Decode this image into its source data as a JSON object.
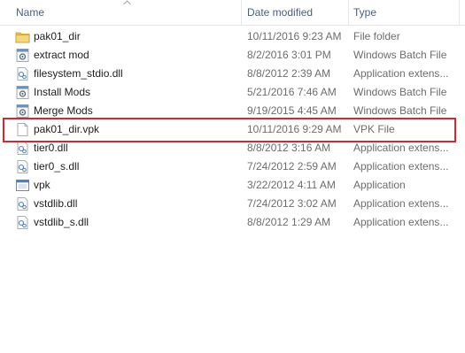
{
  "columns": {
    "name": "Name",
    "date": "Date modified",
    "type": "Type"
  },
  "colors": {
    "highlight": "#d7262f",
    "header_text": "#4c607a",
    "detail_text": "#6d6d6d"
  },
  "files": [
    {
      "name": "pak01_dir",
      "date": "10/11/2016 9:23 AM",
      "type": "File folder",
      "icon": "folder-icon"
    },
    {
      "name": "extract mod",
      "date": "8/2/2016 3:01 PM",
      "type": "Windows Batch File",
      "icon": "batch-file-icon"
    },
    {
      "name": "filesystem_stdio.dll",
      "date": "8/8/2012 2:39 AM",
      "type": "Application extens...",
      "icon": "dll-file-icon"
    },
    {
      "name": "Install Mods",
      "date": "5/21/2016 7:46 AM",
      "type": "Windows Batch File",
      "icon": "batch-file-icon"
    },
    {
      "name": "Merge Mods",
      "date": "9/19/2015 4:45 AM",
      "type": "Windows Batch File",
      "icon": "batch-file-icon"
    },
    {
      "name": "pak01_dir.vpk",
      "date": "10/11/2016 9:29 AM",
      "type": "VPK File",
      "icon": "blank-file-icon"
    },
    {
      "name": "tier0.dll",
      "date": "8/8/2012 3:16 AM",
      "type": "Application extens...",
      "icon": "dll-file-icon"
    },
    {
      "name": "tier0_s.dll",
      "date": "7/24/2012 2:59 AM",
      "type": "Application extens...",
      "icon": "dll-file-icon"
    },
    {
      "name": "vpk",
      "date": "3/22/2012 4:11 AM",
      "type": "Application",
      "icon": "application-icon"
    },
    {
      "name": "vstdlib.dll",
      "date": "7/24/2012 3:02 AM",
      "type": "Application extens...",
      "icon": "dll-file-icon"
    },
    {
      "name": "vstdlib_s.dll",
      "date": "8/8/2012 1:29 AM",
      "type": "Application extens...",
      "icon": "dll-file-icon"
    }
  ]
}
